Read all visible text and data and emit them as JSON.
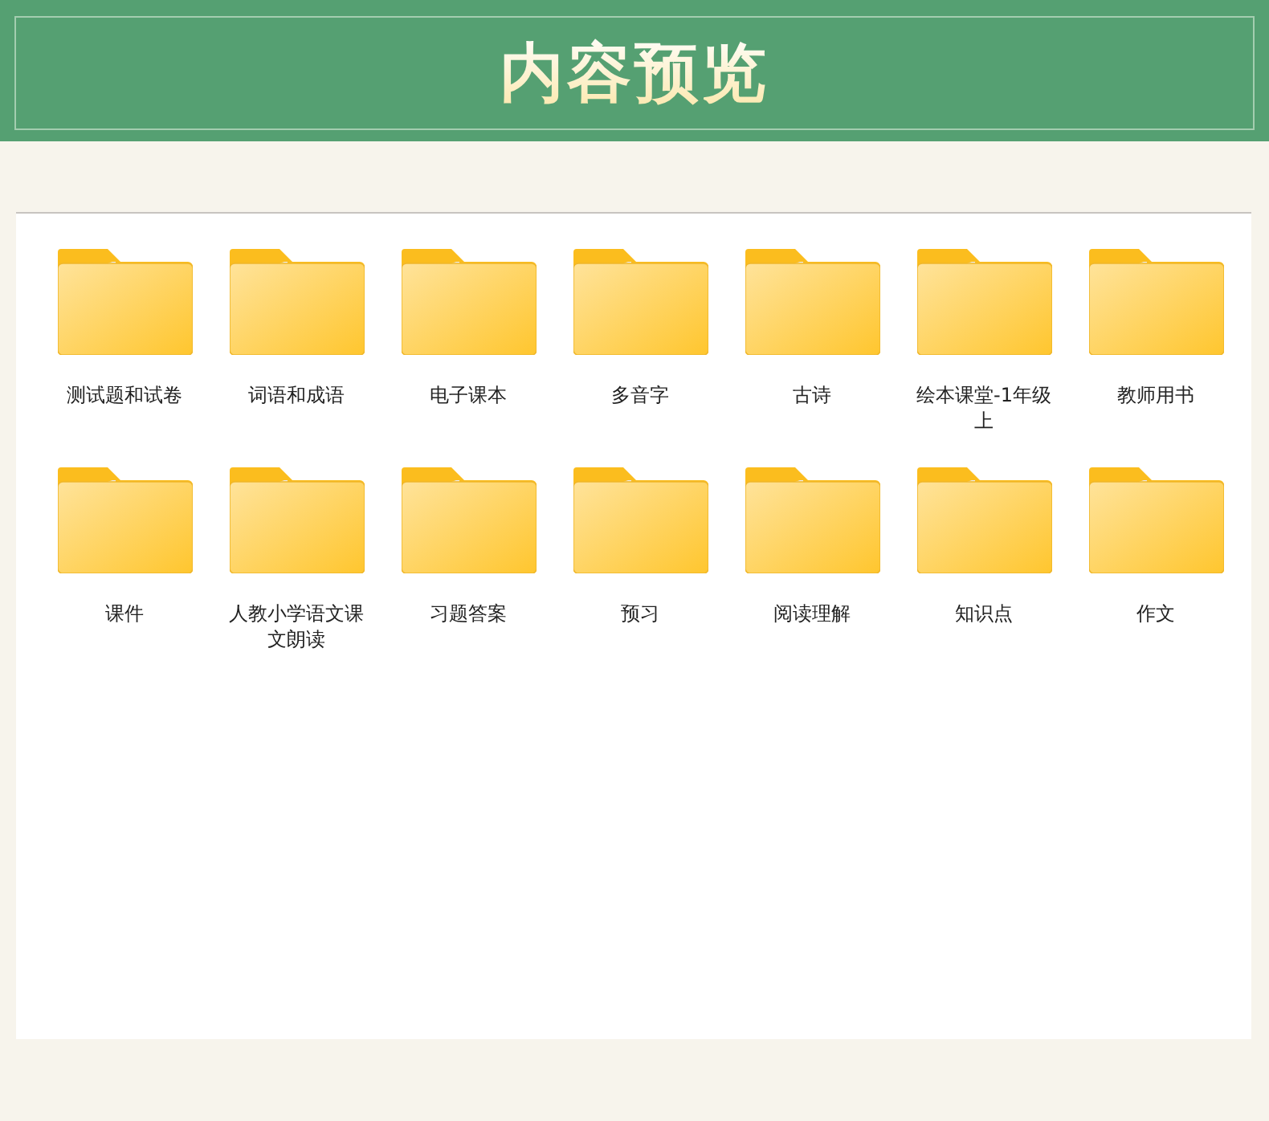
{
  "header": {
    "title": "内容预览"
  },
  "folders": [
    {
      "name": "测试题和试卷"
    },
    {
      "name": "词语和成语"
    },
    {
      "name": "电子课本"
    },
    {
      "name": "多音字"
    },
    {
      "name": "古诗"
    },
    {
      "name": "绘本课堂-1年级上"
    },
    {
      "name": "教师用书"
    },
    {
      "name": "课件"
    },
    {
      "name": "人教小学语文课文朗读"
    },
    {
      "name": "习题答案"
    },
    {
      "name": "预习"
    },
    {
      "name": "阅读理解"
    },
    {
      "name": "知识点"
    },
    {
      "name": "作文"
    }
  ]
}
